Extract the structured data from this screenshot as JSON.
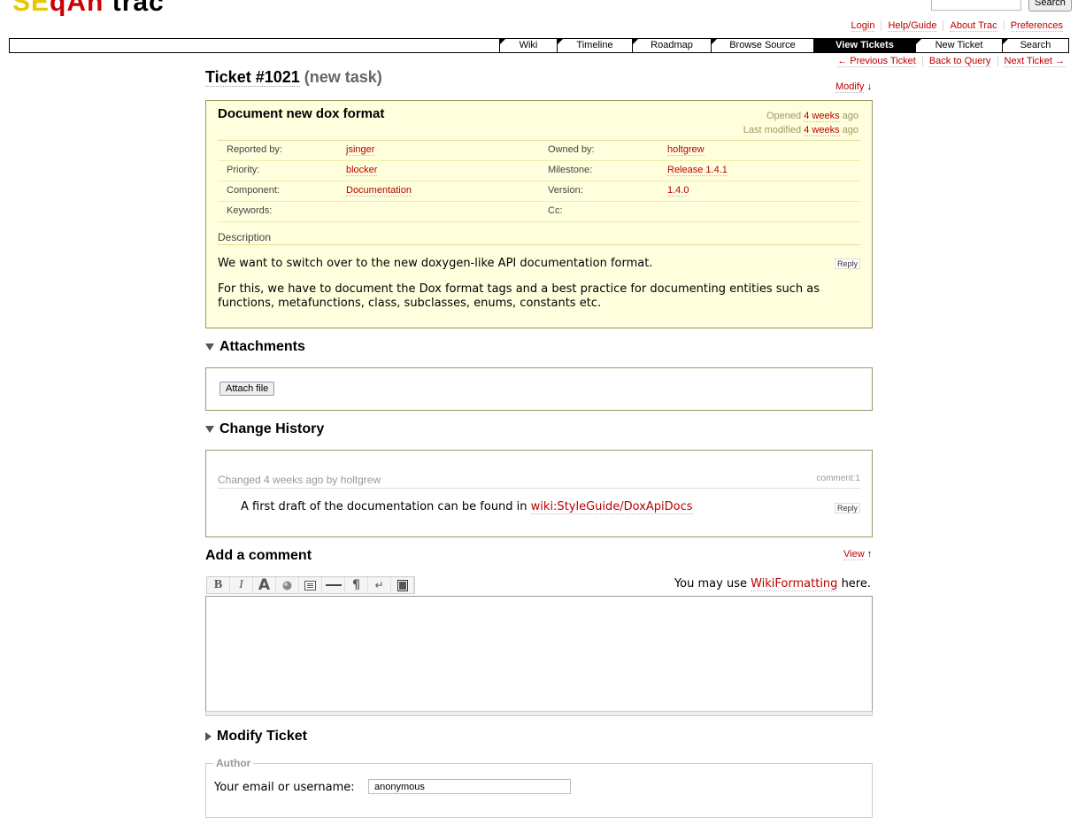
{
  "header": {
    "logo_text_a": "SE",
    "logo_text_b": "qAn",
    "logo_text_c": "trac",
    "search_button": "Search"
  },
  "metanav": [
    "Login",
    "Help/Guide",
    "About Trac",
    "Preferences"
  ],
  "mainnav": [
    {
      "label": "Wiki",
      "active": false
    },
    {
      "label": "Timeline",
      "active": false
    },
    {
      "label": "Roadmap",
      "active": false
    },
    {
      "label": "Browse Source",
      "active": false
    },
    {
      "label": "View Tickets",
      "active": true
    },
    {
      "label": "New Ticket",
      "active": false
    },
    {
      "label": "Search",
      "active": false
    }
  ],
  "ctxtnav": {
    "prev": "← Previous Ticket",
    "back": "Back to Query",
    "next": "Next Ticket →"
  },
  "ticket": {
    "number": "Ticket #1021",
    "type": "(new task)",
    "modify_link": "Modify",
    "modify_arrow": "↓",
    "summary": "Document new dox format",
    "opened_prefix": "Opened",
    "opened_age": "4 weeks",
    "opened_suffix": "ago",
    "modified_prefix": "Last modified",
    "modified_age": "4 weeks",
    "modified_suffix": "ago",
    "props": [
      {
        "h1": "Reported by:",
        "v1": "jsinger",
        "h2": "Owned by:",
        "v2": "holtgrew"
      },
      {
        "h1": "Priority:",
        "v1": "blocker",
        "h2": "Milestone:",
        "v2": "Release 1.4.1"
      },
      {
        "h1": "Component:",
        "v1": "Documentation",
        "h2": "Version:",
        "v2": "1.4.0"
      },
      {
        "h1": "Keywords:",
        "v1": "",
        "h2": "Cc:",
        "v2": ""
      }
    ],
    "description_heading": "Description",
    "description_p1": "We want to switch over to the new doxygen-like API documentation format.",
    "description_p2": "For this, we have to document the Dox format tags and a best practice for documenting entities such as functions, metafunctions, class, subclasses, enums, constants etc.",
    "reply_label": "Reply"
  },
  "attachments": {
    "heading": "Attachments",
    "button": "Attach file"
  },
  "history": {
    "heading": "Change History",
    "change_header": "Changed 4 weeks ago by holtgrew",
    "comment_num": "comment:1",
    "comment_text": "A first draft of the documentation can be found in ",
    "comment_link": "wiki:StyleGuide/DoxApiDocs",
    "reply_label": "Reply"
  },
  "add_comment": {
    "heading": "Add a comment",
    "view_link": "View",
    "view_arrow": "↑",
    "toolbar_icons": [
      "bold-icon",
      "italic-icon",
      "heading-icon",
      "link-icon",
      "codeblock-icon",
      "hr-icon",
      "paragraph-icon",
      "linebreak-icon",
      "image-icon"
    ],
    "note_prefix": "You may use ",
    "note_link": "WikiFormatting",
    "note_suffix": " here."
  },
  "modify": {
    "heading": "Modify Ticket",
    "author_legend": "Author",
    "author_label": "Your email or username:",
    "author_value": "anonymous"
  }
}
